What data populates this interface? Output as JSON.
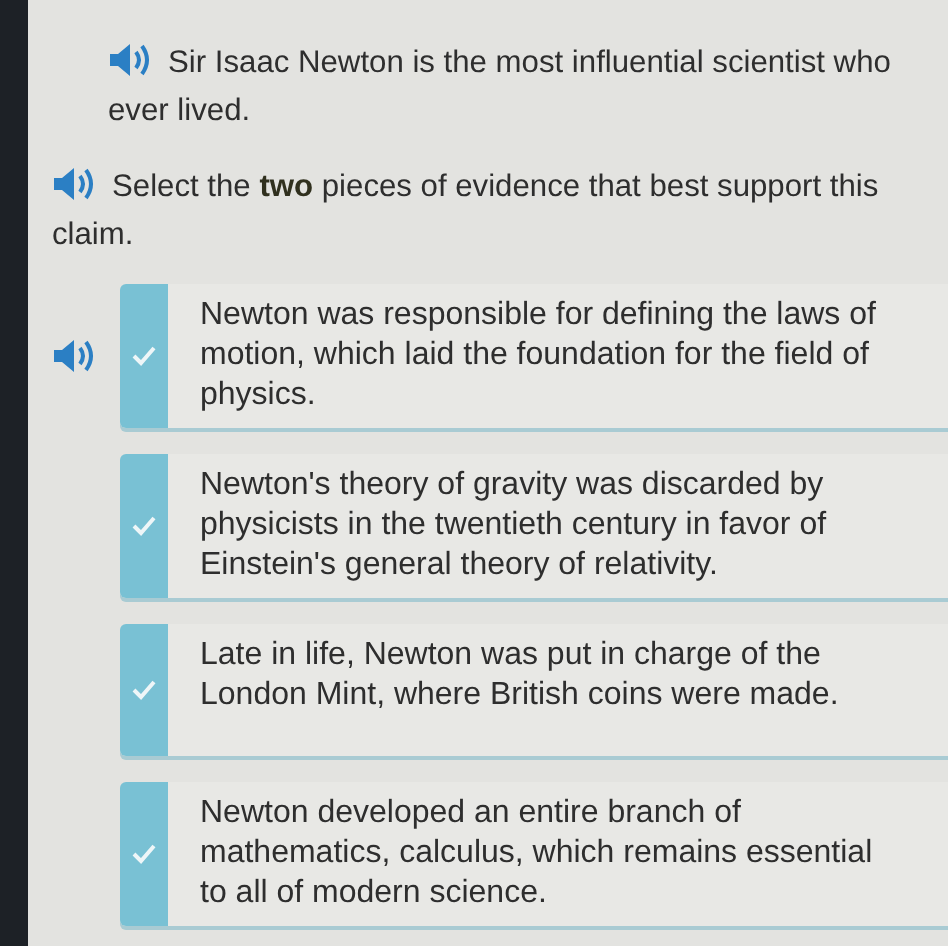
{
  "claim": {
    "text": "Sir Isaac Newton is the most influential scientist who ever lived.",
    "audio": true
  },
  "prompt": {
    "text": "Select the **two** pieces of evidence that best support this claim.",
    "audio": true
  },
  "options": [
    {
      "text": "Newton was responsible for defining the laws of motion, which laid the foundation for the field of physics.",
      "selected": false,
      "audio": true
    },
    {
      "text": "Newton's theory of gravity was discarded by physicists in the twentieth century in favor of Einstein's general theory of relativity.",
      "selected": false,
      "audio": false
    },
    {
      "text": "Late in life, Newton was put in charge of the London Mint, where British coins were made.",
      "selected": false,
      "audio": false
    },
    {
      "text": "Newton developed an entire branch of mathematics, calculus, which remains essential to all of modern science.",
      "selected": false,
      "audio": false
    }
  ]
}
